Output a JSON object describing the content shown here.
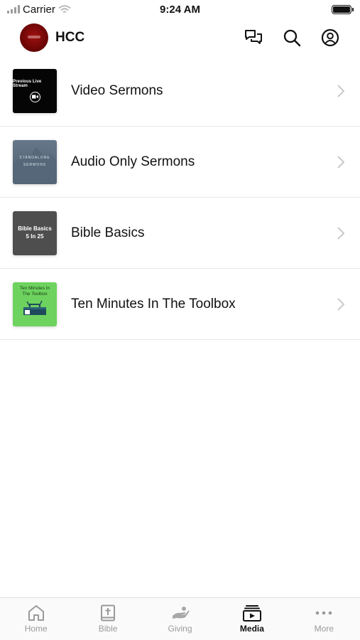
{
  "status_bar": {
    "carrier": "Carrier",
    "time": "9:24 AM",
    "battery_level": 1.0
  },
  "header": {
    "title": "HCC",
    "logo_color": "#8b0a0a",
    "actions": [
      "chat-icon",
      "search-icon",
      "account-icon"
    ]
  },
  "media": {
    "items": [
      {
        "label": "Video Sermons",
        "thumb_text": "Previous Live Stream",
        "icon": "video-camera-icon"
      },
      {
        "label": "Audio Only Sermons",
        "thumb_line1": "STANDALONE",
        "thumb_line2": "SERMONS"
      },
      {
        "label": "Bible Basics",
        "thumb_line1": "Bible Basics",
        "thumb_line2": "5 In 25"
      },
      {
        "label": "Ten Minutes In The Toolbox",
        "thumb_line1": "Ten Minutes In",
        "thumb_line2": "The Toolbox"
      }
    ]
  },
  "tab_bar": {
    "active": "Media",
    "active_color": "#111111",
    "inactive_color": "#9a9a9a",
    "tabs": [
      {
        "label": "Home",
        "icon": "home-icon"
      },
      {
        "label": "Bible",
        "icon": "bible-icon"
      },
      {
        "label": "Giving",
        "icon": "giving-hand-icon"
      },
      {
        "label": "Media",
        "icon": "media-play-icon"
      },
      {
        "label": "More",
        "icon": "more-dots-icon"
      }
    ]
  }
}
